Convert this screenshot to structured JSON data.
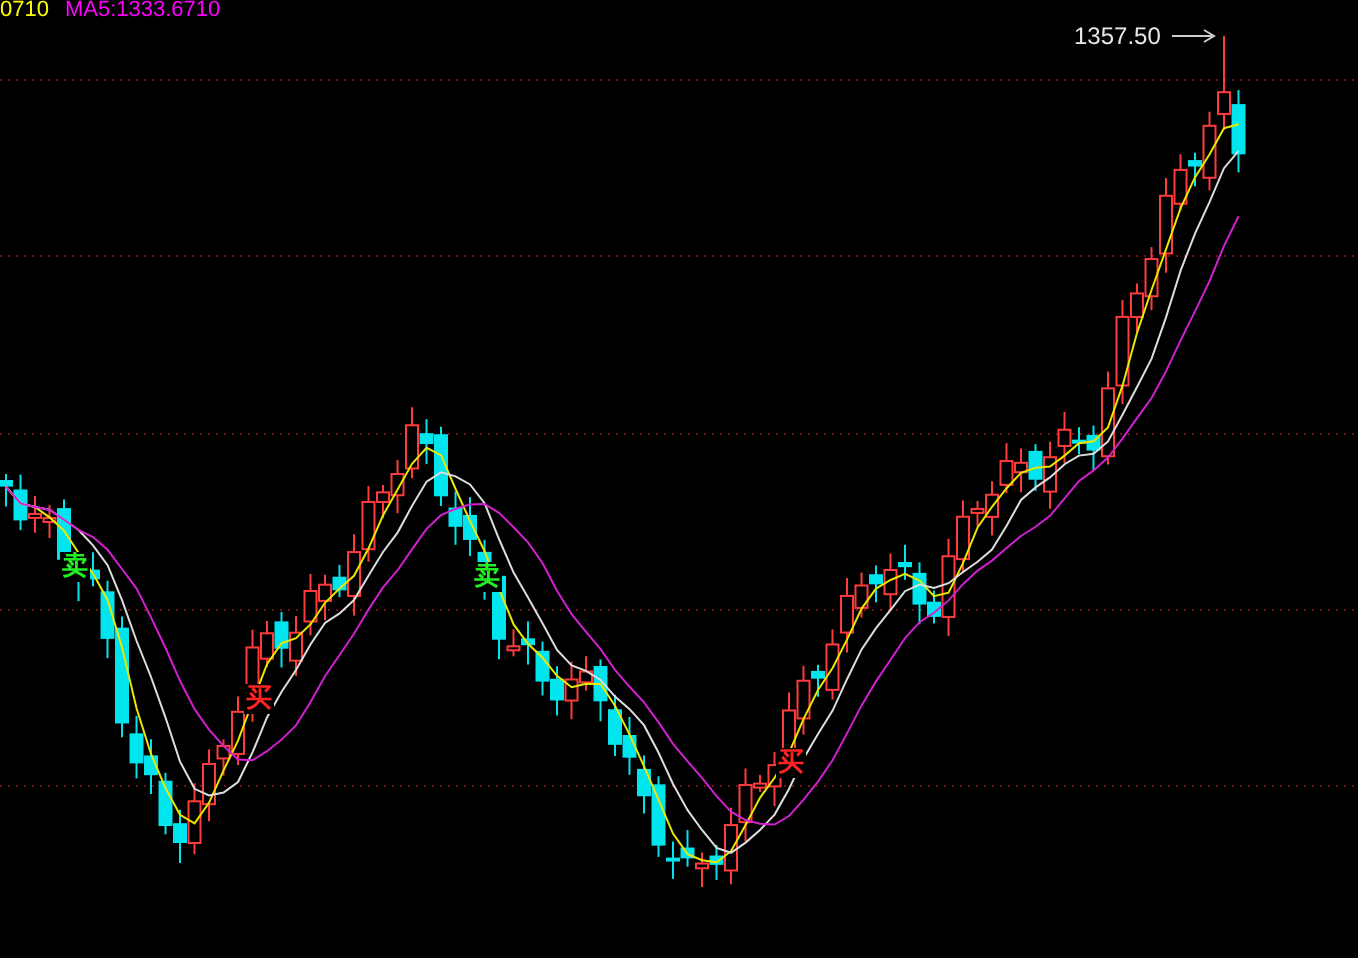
{
  "chart": {
    "legend": [
      {
        "text": "0710",
        "color": "#ffff00"
      },
      {
        "text": "MA5:1333.6710",
        "color": "#ff00ff"
      }
    ],
    "high_label": "1357.50",
    "signals": [
      {
        "kind": "sell",
        "text": "卖"
      },
      {
        "kind": "buy",
        "text": "买"
      },
      {
        "kind": "sell",
        "text": "卖"
      },
      {
        "kind": "buy",
        "text": "买"
      }
    ]
  }
}
